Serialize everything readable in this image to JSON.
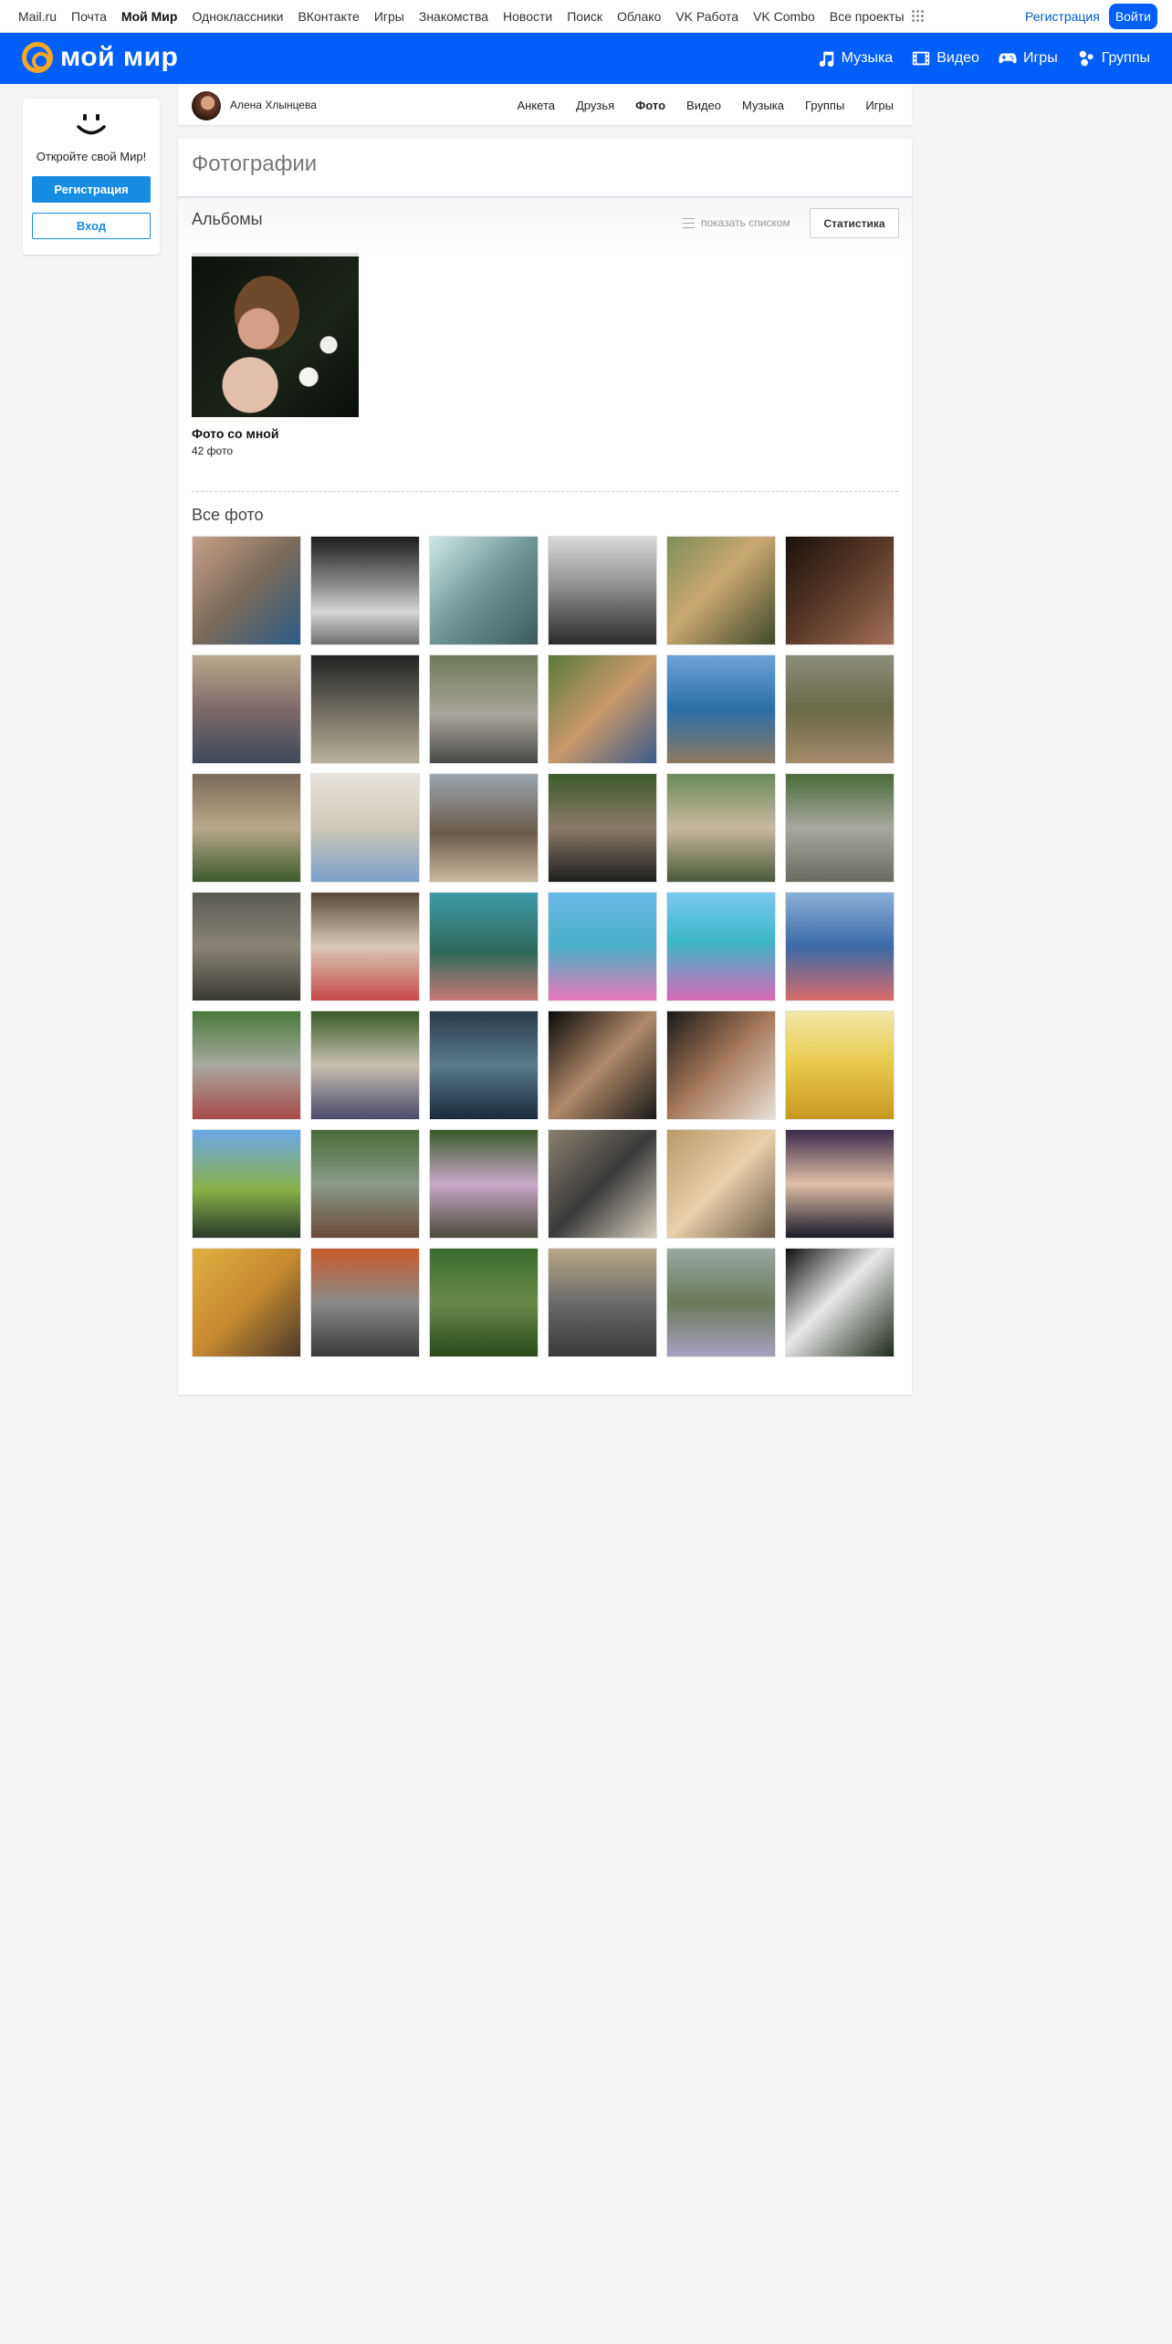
{
  "portal": {
    "links": [
      "Mail.ru",
      "Почта",
      "Мой Мир",
      "Одноклассники",
      "ВКонтакте",
      "Игры",
      "Знакомства",
      "Новости",
      "Поиск",
      "Облако",
      "VK Работа",
      "VK Combo",
      "Все проекты"
    ],
    "active": "Мой Мир",
    "register": "Регистрация",
    "login": "Войти"
  },
  "header": {
    "logo_text": "мой мир",
    "nav": [
      {
        "label": "Музыка",
        "icon": "music-note-icon"
      },
      {
        "label": "Видео",
        "icon": "film-icon"
      },
      {
        "label": "Игры",
        "icon": "gamepad-icon"
      },
      {
        "label": "Группы",
        "icon": "group-icon"
      }
    ]
  },
  "leftcard": {
    "icon": "smile-icon",
    "promo": "Откройте свой Мир!",
    "register_label": "Регистрация",
    "login_label": "Вход"
  },
  "profile": {
    "name": "Алена Хлынцева",
    "tabs": [
      "Анкета",
      "Друзья",
      "Фото",
      "Видео",
      "Музыка",
      "Группы",
      "Игры"
    ],
    "active_tab": "Фото"
  },
  "photos": {
    "title": "Фотографии",
    "albums_heading": "Альбомы",
    "show_list": "показать списком",
    "stats": "Статистика",
    "album": {
      "name": "Фото со мной",
      "count": "42 фото"
    },
    "all_heading": "Все фото",
    "thumb_count": 42
  },
  "colors": {
    "brand_blue": "#005ff9",
    "button_blue": "#168de2",
    "logo_orange": "#f9a825"
  }
}
